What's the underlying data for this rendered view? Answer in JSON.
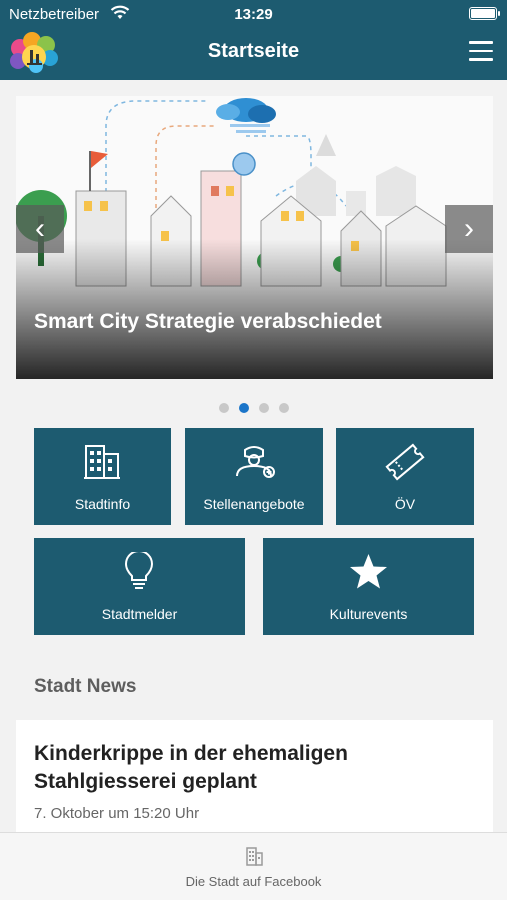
{
  "status_bar": {
    "carrier": "Netzbetreiber",
    "time": "13:29"
  },
  "header": {
    "title": "Startseite",
    "logo_icon": "city-logo-icon",
    "menu_icon": "hamburger-menu-icon"
  },
  "carousel": {
    "caption": "Smart City Strategie verabschiedet",
    "prev_icon": "chevron-left-icon",
    "next_icon": "chevron-right-icon",
    "slide_count": 4,
    "active_index": 1
  },
  "tiles": [
    {
      "label": "Stadtinfo",
      "icon": "building-icon"
    },
    {
      "label": "Stellenangebote",
      "icon": "job-search-icon"
    },
    {
      "label": "ÖV",
      "icon": "ticket-icon"
    },
    {
      "label": "Stadtmelder",
      "icon": "lightbulb-icon"
    },
    {
      "label": "Kulturevents",
      "icon": "star-icon"
    }
  ],
  "news": {
    "section_title": "Stadt News",
    "items": [
      {
        "headline": "Kinderkrippe in der ehemaligen Stahlgiesserei geplant",
        "date": "7. Oktober um 15:20 Uhr"
      }
    ]
  },
  "footer": {
    "label": "Die Stadt auf Facebook",
    "icon": "building-icon"
  },
  "colors": {
    "primary": "#1d5b70",
    "dot_active": "#1b75c9",
    "dot_inactive": "#c8c8c8",
    "background": "#f2f2f2"
  }
}
